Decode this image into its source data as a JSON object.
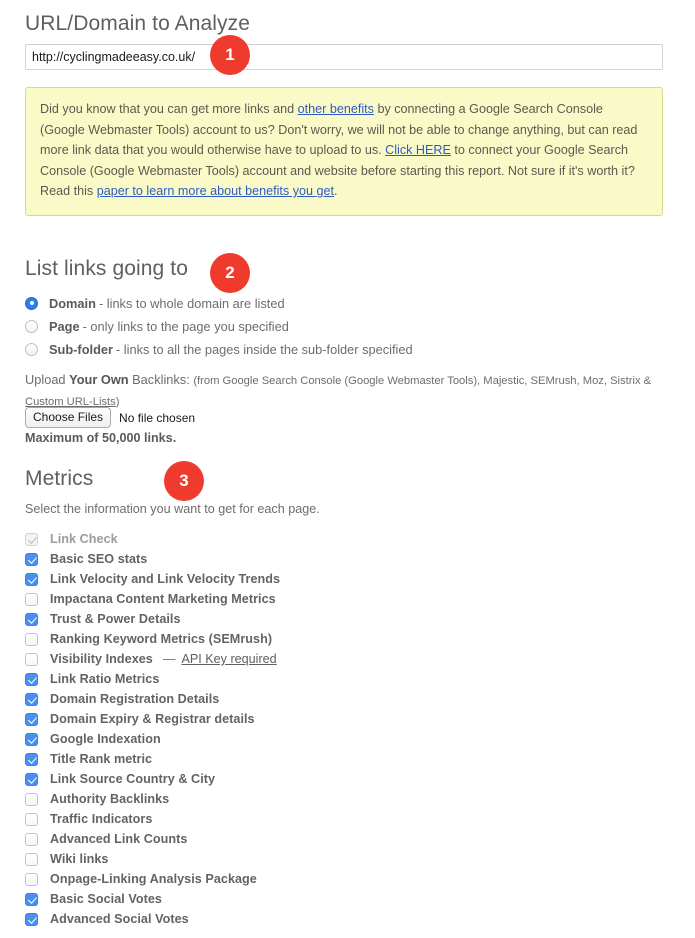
{
  "url_section": {
    "heading": "URL/Domain to Analyze",
    "input_value": "http://cyclingmadeeasy.co.uk/",
    "input_placeholder": "",
    "badge": "1"
  },
  "notice": {
    "part1": "Did you know that you can get more links and ",
    "link1": "other benefits",
    "part2": " by connecting a Google Search Console (Google Webmaster Tools) account to us? Don't worry, we will not be able to change anything, but can read more link data that you would otherwise have to upload to us. ",
    "link2": "Click HERE",
    "part3": " to connect your Google Search Console (Google Webmaster Tools) account and website before starting this report. Not sure if it's worth it? Read this ",
    "link3": "paper to learn more about benefits you get",
    "part4": "."
  },
  "list_links": {
    "heading": "List links going to",
    "badge": "2",
    "options": [
      {
        "label": "Domain",
        "desc": " - links to whole domain are listed",
        "selected": true
      },
      {
        "label": "Page",
        "desc": " - only links to the page you specified",
        "selected": false
      },
      {
        "label": "Sub-folder",
        "desc": " - links to all the pages inside the sub-folder specified",
        "selected": false
      }
    ]
  },
  "upload": {
    "lead": "Upload ",
    "strong": "Your Own",
    "lead2": " Backlinks: ",
    "sources": "(from Google Search Console (Google Webmaster Tools), Majestic, SEMrush, Moz, Sistrix & ",
    "sources_link": "Custom URL-Lists",
    "sources_end": ")",
    "choose_button": "Choose Files",
    "no_file": "No file chosen",
    "maximum": "Maximum of 50,000 links."
  },
  "metrics": {
    "heading": "Metrics",
    "badge": "3",
    "subtitle": "Select the information you want to get for each page.",
    "items": [
      {
        "label": "Link Check",
        "checked": true,
        "disabled": true,
        "note": "",
        "note_link": ""
      },
      {
        "label": "Basic SEO stats",
        "checked": true,
        "disabled": false,
        "note": "",
        "note_link": ""
      },
      {
        "label": "Link Velocity and Link Velocity Trends",
        "checked": true,
        "disabled": false,
        "note": "",
        "note_link": ""
      },
      {
        "label": "Impactana Content Marketing Metrics",
        "checked": false,
        "disabled": false,
        "note": "",
        "note_link": ""
      },
      {
        "label": "Trust & Power Details",
        "checked": true,
        "disabled": false,
        "note": "",
        "note_link": ""
      },
      {
        "label": "Ranking Keyword Metrics (SEMrush)",
        "checked": false,
        "disabled": false,
        "note": "",
        "note_link": ""
      },
      {
        "label": "Visibility Indexes",
        "checked": false,
        "disabled": false,
        "note": "—",
        "note_link": "API Key required"
      },
      {
        "label": "Link Ratio Metrics",
        "checked": true,
        "disabled": false,
        "note": "",
        "note_link": ""
      },
      {
        "label": "Domain Registration Details",
        "checked": true,
        "disabled": false,
        "note": "",
        "note_link": ""
      },
      {
        "label": "Domain Expiry & Registrar details",
        "checked": true,
        "disabled": false,
        "note": "",
        "note_link": ""
      },
      {
        "label": "Google Indexation",
        "checked": true,
        "disabled": false,
        "note": "",
        "note_link": ""
      },
      {
        "label": "Title Rank metric",
        "checked": true,
        "disabled": false,
        "note": "",
        "note_link": ""
      },
      {
        "label": "Link Source Country & City",
        "checked": true,
        "disabled": false,
        "note": "",
        "note_link": ""
      },
      {
        "label": "Authority Backlinks",
        "checked": false,
        "disabled": false,
        "note": "",
        "note_link": ""
      },
      {
        "label": "Traffic Indicators",
        "checked": false,
        "disabled": false,
        "note": "",
        "note_link": ""
      },
      {
        "label": "Advanced Link Counts",
        "checked": false,
        "disabled": false,
        "note": "",
        "note_link": ""
      },
      {
        "label": "Wiki links",
        "checked": false,
        "disabled": false,
        "note": "",
        "note_link": ""
      },
      {
        "label": "Onpage-Linking Analysis Package",
        "checked": false,
        "disabled": false,
        "note": "",
        "note_link": ""
      },
      {
        "label": "Basic Social Votes",
        "checked": true,
        "disabled": false,
        "note": "",
        "note_link": ""
      },
      {
        "label": "Advanced Social Votes",
        "checked": true,
        "disabled": false,
        "note": "",
        "note_link": ""
      }
    ]
  },
  "colors": {
    "badge_red": "#ef3b2d",
    "notice_bg": "#fafac9",
    "notice_border": "#d9d98c",
    "link_blue": "#2d5cc0",
    "checkbox_blue": "#4a90f2"
  }
}
